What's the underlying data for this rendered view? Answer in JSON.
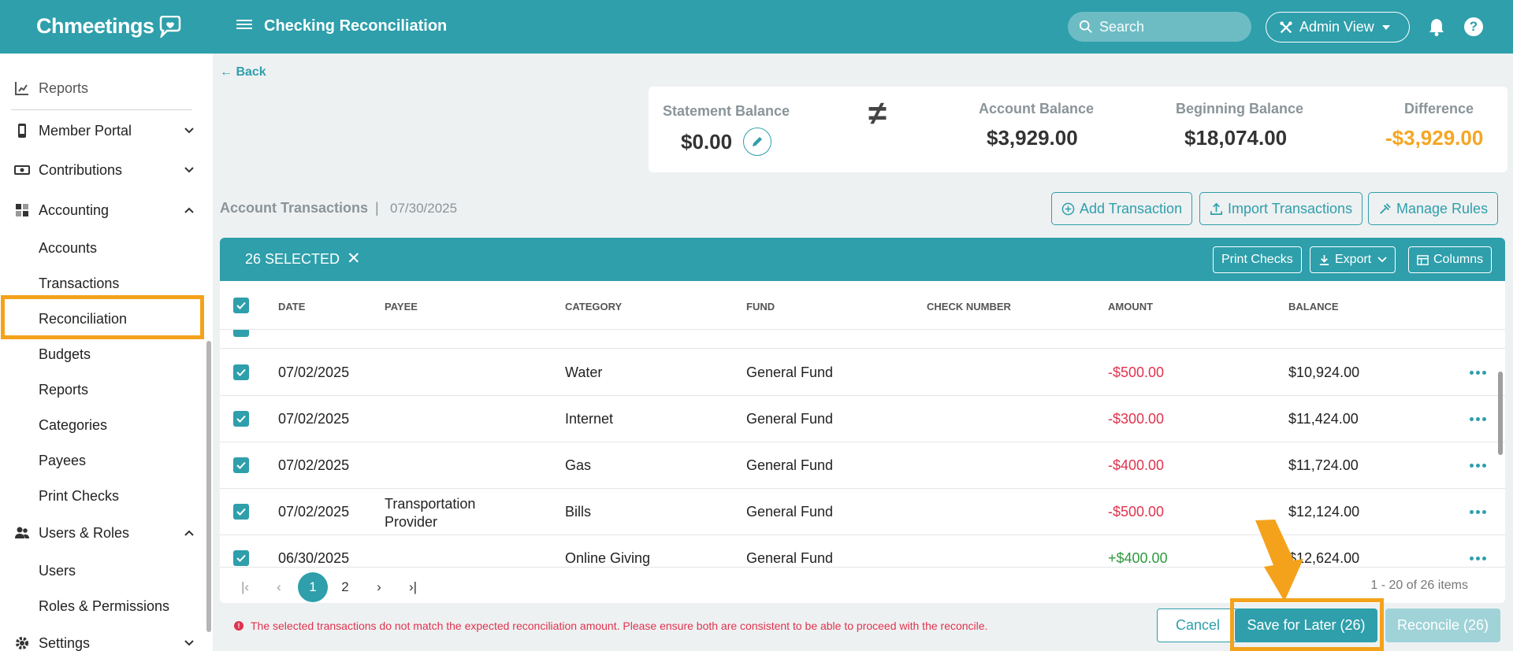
{
  "app": {
    "logo": "Chmeetings",
    "page_title": "Checking Reconciliation",
    "search_placeholder": "Search",
    "admin_view": "Admin View"
  },
  "sidebar": {
    "top_item": "Reports",
    "sections": [
      {
        "label": "Member Portal",
        "icon": "mobile-icon"
      },
      {
        "label": "Contributions",
        "icon": "cash-icon"
      },
      {
        "label": "Accounting",
        "icon": "grid-icon"
      },
      {
        "label": "Users & Roles",
        "icon": "users-icon"
      },
      {
        "label": "Settings",
        "icon": "gear-icon"
      }
    ],
    "accounting_items": [
      "Accounts",
      "Transactions",
      "Reconciliation",
      "Budgets",
      "Reports",
      "Categories",
      "Payees",
      "Print Checks"
    ],
    "users_items": [
      "Users",
      "Roles & Permissions"
    ],
    "active": "Reconciliation"
  },
  "back_label": "Back",
  "balances": {
    "statement_label": "Statement Balance",
    "statement_value": "$0.00",
    "not_equal_symbol": "≠",
    "account_label": "Account Balance",
    "account_value": "$3,929.00",
    "beginning_label": "Beginning Balance",
    "beginning_value": "$18,074.00",
    "difference_label": "Difference",
    "difference_value": "-$3,929.00",
    "difference_color": "#f5a623"
  },
  "section": {
    "title": "Account Transactions",
    "separator": "|",
    "date": "07/30/2025",
    "add_transaction": "Add Transaction",
    "import_transactions": "Import Transactions",
    "manage_rules": "Manage Rules"
  },
  "table": {
    "selected_label": "26 SELECTED",
    "clear_symbol": "✕",
    "print_checks": "Print Checks",
    "export": "Export",
    "columns": "Columns",
    "headers": [
      "DATE",
      "PAYEE",
      "CATEGORY",
      "FUND",
      "CHECK NUMBER",
      "AMOUNT",
      "BALANCE"
    ],
    "rows": [
      {
        "date": "07/02/2025",
        "payee": "",
        "category": "Water",
        "fund": "General Fund",
        "check": "",
        "amount": "-$500.00",
        "balance": "$10,924.00"
      },
      {
        "date": "07/02/2025",
        "payee": "",
        "category": "Internet",
        "fund": "General Fund",
        "check": "",
        "amount": "-$300.00",
        "balance": "$11,424.00"
      },
      {
        "date": "07/02/2025",
        "payee": "",
        "category": "Gas",
        "fund": "General Fund",
        "check": "",
        "amount": "-$400.00",
        "balance": "$11,724.00"
      },
      {
        "date": "07/02/2025",
        "payee": "Transportation Provider",
        "category": "Bills",
        "fund": "General Fund",
        "check": "",
        "amount": "-$500.00",
        "balance": "$12,124.00"
      },
      {
        "date": "06/30/2025",
        "payee": "",
        "category": "Online Giving",
        "fund": "General Fund",
        "check": "",
        "amount": "+$400.00",
        "balance": "$12,624.00"
      }
    ],
    "pages": [
      "1",
      "2"
    ],
    "current_page": "1",
    "range_info": "1 - 20 of 26 items"
  },
  "footer": {
    "error": "The selected transactions do not match the expected reconciliation amount. Please ensure both are consistent to be able to proceed with the reconcile.",
    "cancel": "Cancel",
    "save_for_later": "Save for Later (26)",
    "reconcile": "Reconcile (26)"
  },
  "colors": {
    "brand": "#2e9fab",
    "highlight": "#f4a21c",
    "negative": "#e0334e",
    "positive": "#2e9a3d"
  }
}
